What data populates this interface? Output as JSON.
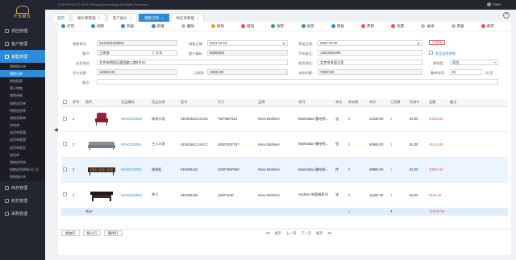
{
  "app": {
    "copyright": "COPYRIGHT © 2021 Fsshang Technology All Rights Reserved",
    "user": "FSMS",
    "logo": "FSMS"
  },
  "sidebar": {
    "groups": [
      {
        "label": "供应管理"
      },
      {
        "label": "客户管理"
      },
      {
        "label": "销售管理"
      }
    ],
    "subitems": [
      {
        "label": "销售报价单"
      },
      {
        "label": "销售订单"
      },
      {
        "label": "销售报表"
      },
      {
        "label": "预计销售"
      },
      {
        "label": "销售单据"
      },
      {
        "label": "销售送货单"
      },
      {
        "label": "销售退货单"
      },
      {
        "label": "销售发票单"
      },
      {
        "label": "应收单"
      },
      {
        "label": "送货单管理"
      },
      {
        "label": "退货单管理"
      },
      {
        "label": "退货单收货"
      },
      {
        "label": "退货单"
      },
      {
        "label": "销售退货单"
      },
      {
        "label": "销售退货单统计汇总"
      },
      {
        "label": "销售报价单"
      }
    ],
    "bottom_groups": [
      {
        "label": "库存管理"
      },
      {
        "label": "财务管理"
      },
      {
        "label": "采购管理"
      }
    ]
  },
  "tabs": [
    {
      "label": "首页"
    },
    {
      "label": "图片库管理"
    },
    {
      "label": "客户报价"
    },
    {
      "label": "销售订单"
    },
    {
      "label": "供应商管理"
    }
  ],
  "toolbar": {
    "buttons": [
      {
        "label": "打印",
        "color": "#2f8bd8"
      },
      {
        "label": "刷新",
        "color": "#2f8bd8"
      },
      {
        "label": "列表",
        "color": "#2f8bd8"
      },
      {
        "label": "新增",
        "color": "#2f8bd8"
      },
      {
        "label": "删除",
        "color": "#bbbbbb"
      },
      {
        "label": "修改",
        "color": "#f0a020"
      },
      {
        "label": "取消",
        "color": "#e35454"
      },
      {
        "label": "保存",
        "color": "#3aa35a"
      },
      {
        "label": "退货",
        "color": "#2f8bd8"
      },
      {
        "label": "审批",
        "color": "#2f8bd8"
      },
      {
        "label": "弃审",
        "color": "#e35454"
      },
      {
        "label": "作废",
        "color": "#e35454"
      },
      {
        "label": "关闭",
        "color": "#bbbbbb"
      },
      {
        "label": "审核",
        "color": "#bbbbbb"
      },
      {
        "label": "保存",
        "color": "#e35454"
      }
    ]
  },
  "form": {
    "order_no_label": "销售单号:",
    "order_no": "XS21101300001",
    "order_date_label": "销售日期:",
    "order_date": "2021-10-13",
    "delivery_date_label": "预送日期:",
    "delivery_date": "2021-10-20",
    "status_tag": "已完成",
    "customer_label": "客户:",
    "customer": "王晓强",
    "customer_btn": "新增",
    "customer_no_label": "客户编码:",
    "customer_no": "00000021",
    "phone_label": "手机电话:",
    "phone": "13823652099",
    "checkbox_label": "是否加急销售",
    "address_label": "送货地址:",
    "address": "北京市朝阳区建国路二期8号5A",
    "receiver_addr_label": "收货地址:",
    "receiver_addr": "北京市家居之家",
    "payment_label": "收款类:",
    "payment": "现金",
    "total_label": "合计金额:",
    "total": "119930.00",
    "received_label": "已收款:",
    "received": "41930.00",
    "unpaid_label": "未收余额:",
    "unpaid": "78000.00",
    "discount_label": "整单折扣:",
    "discount": "82",
    "discount_suffix": "元/百",
    "remark_label": "备注:",
    "remark": ""
  },
  "table": {
    "headers": [
      "",
      "序号",
      "图片",
      "货品编码",
      "货品名称",
      "型号",
      "尺寸",
      "品牌",
      "系列",
      "单位",
      "库存数",
      "单价",
      "订货数",
      "折扣%",
      "金额",
      "备注"
    ],
    "rows": [
      {
        "seq": "1",
        "code": "KENO215003",
        "name": "休闲沙发",
        "model": "KENO4224.0ACD",
        "size": "760*890*813",
        "brand": "Keno Brothers",
        "series": "Manhattan-曼哈顿...",
        "unit": "张",
        "stock": "5",
        "price": "24430.00",
        "qty": "1",
        "discount": "82.00",
        "amount": "20032.60",
        "remark": ""
      },
      {
        "seq": "2",
        "code": "KENO110001",
        "name": "三人沙发",
        "model": "KENO4612.3ACC",
        "size": "2600*920*787",
        "brand": "Keno Brothers",
        "series": "Manhattan-曼哈顿...",
        "unit": "张",
        "stock": "5",
        "price": "50990.00",
        "qty": "1",
        "discount": "82.00",
        "amount": "41811.80",
        "remark": ""
      },
      {
        "seq": "3",
        "code": "KENO110001",
        "name": "电视柜",
        "model": "KENO6142",
        "size": "2200*450*500",
        "brand": "Keno Brothers",
        "series": "Manhattan-曼哈顿...",
        "unit": "件",
        "stock": "5",
        "price": "49880.00",
        "qty": "1",
        "discount": "82.00",
        "amount": "40901.60",
        "remark": ""
      },
      {
        "seq": "4",
        "code": "KENO210002",
        "name": "茶几",
        "model": "KENO6135",
        "size": "1100*1100",
        "brand": "Keno Brothers",
        "series": "Hudson-哈德森系列",
        "unit": "张",
        "stock": "5",
        "price": "11200.00",
        "qty": "1",
        "discount": "82.00",
        "amount": "9184.00",
        "remark": ""
      }
    ],
    "total_label": "合计:",
    "total_stock": "1",
    "total_qty": "4",
    "total_amount": "111930.00"
  },
  "bottombar": {
    "buttons": [
      {
        "label": "增加行"
      },
      {
        "label": "插入行"
      },
      {
        "label": "删除行"
      }
    ],
    "pager": {
      "first": "首页",
      "prev": "上一页",
      "next": "下一页",
      "last": "尾页"
    }
  },
  "colors": {
    "accent": "#2f8bd8",
    "danger": "#e35454",
    "sidebar": "#23262e"
  }
}
